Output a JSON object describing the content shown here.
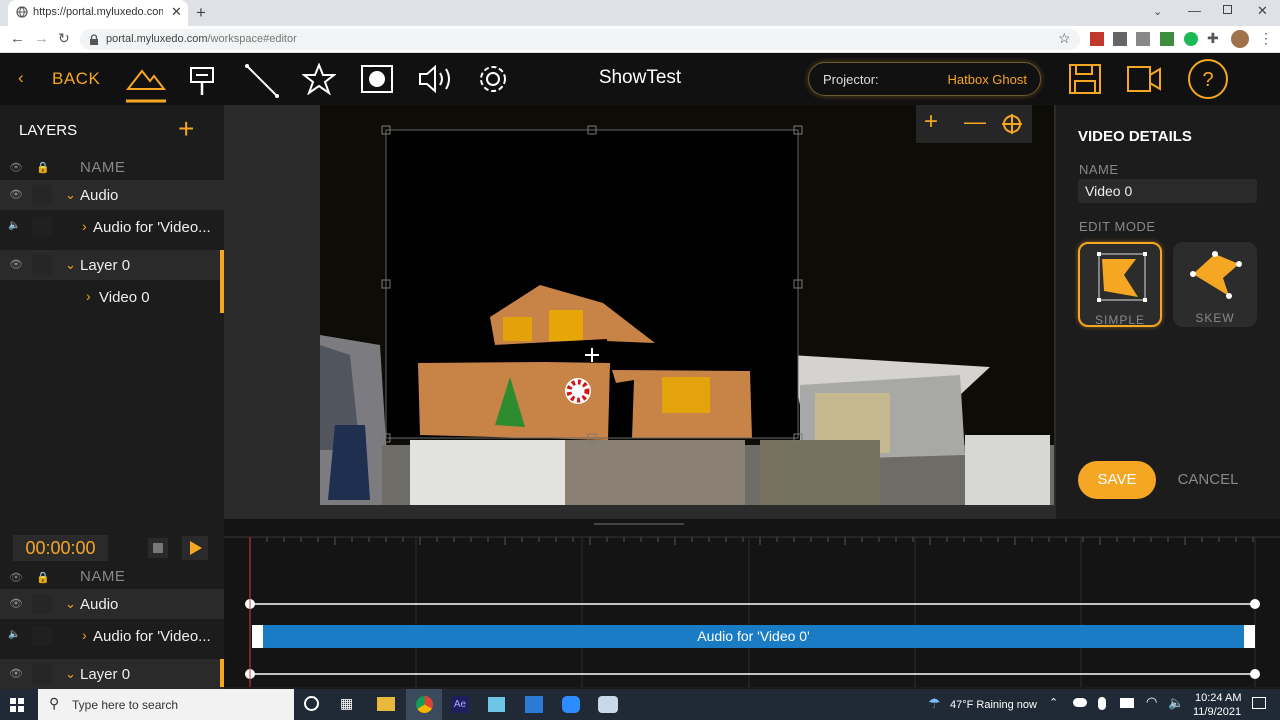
{
  "browser": {
    "tab_title": "https://portal.myluxedo.com/wo",
    "url_host": "portal.myluxedo.com",
    "url_path": "/workspace#editor"
  },
  "header": {
    "back_label": "BACK",
    "title": "ShowTest",
    "projector_label": "Projector:",
    "projector_value": "Hatbox Ghost",
    "accent_color": "#f5a623"
  },
  "toolbar": {
    "tools": [
      "layers-tool-icon",
      "text-tool-icon",
      "line-tool-icon",
      "star-tool-icon",
      "record-tool-icon",
      "audio-tool-icon",
      "settings-icon"
    ],
    "right": [
      "save-icon",
      "camera-icon",
      "help-icon"
    ]
  },
  "layers": {
    "title": "LAYERS",
    "column_name": "NAME",
    "rows": [
      {
        "label": "Audio",
        "kind": "group"
      },
      {
        "label": "Audio for 'Video...",
        "kind": "child"
      },
      {
        "label": "Layer 0",
        "kind": "group"
      },
      {
        "label": "Video 0",
        "kind": "child"
      }
    ]
  },
  "details": {
    "title": "VIDEO DETAILS",
    "name_label": "NAME",
    "name_value": "Video 0",
    "edit_mode_label": "EDIT MODE",
    "modes": [
      {
        "label": "SIMPLE",
        "selected": true
      },
      {
        "label": "SKEW",
        "selected": false
      }
    ],
    "save_label": "SAVE",
    "cancel_label": "CANCEL"
  },
  "timeline": {
    "timecode": "00:00:00",
    "column_name": "NAME",
    "rows": [
      {
        "label": "Audio"
      },
      {
        "label": "Audio for 'Video..."
      },
      {
        "label": "Layer 0"
      }
    ],
    "clip_label": "Audio for 'Video 0'",
    "clip_color": "#1a7cc4"
  },
  "taskbar": {
    "search_placeholder": "Type here to search",
    "weather": "47°F  Raining now",
    "time": "10:24 AM",
    "date": "11/9/2021"
  }
}
